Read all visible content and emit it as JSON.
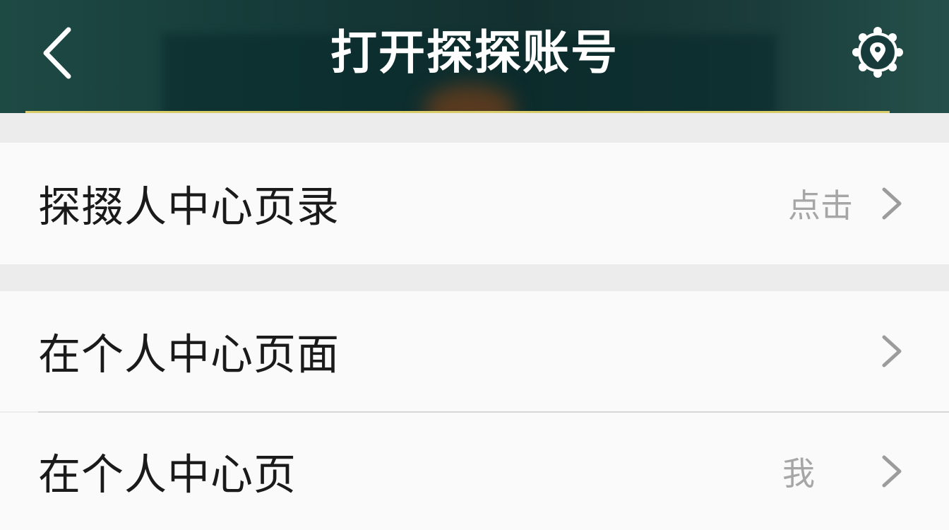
{
  "header": {
    "title": "打开探探账号",
    "back_icon": "chevron-left-icon",
    "settings_icon": "gear-location-icon",
    "underline_color": "#d9cc6a"
  },
  "list": {
    "rows": [
      {
        "label": "探掇人中心页录",
        "value": "点击",
        "icon": "chevron-right-icon"
      },
      {
        "label": "在个人中心页面",
        "value": "",
        "icon": "chevron-right-icon"
      },
      {
        "label": "在个人中心页",
        "value": "我",
        "icon": "chevron-right-icon"
      }
    ]
  }
}
